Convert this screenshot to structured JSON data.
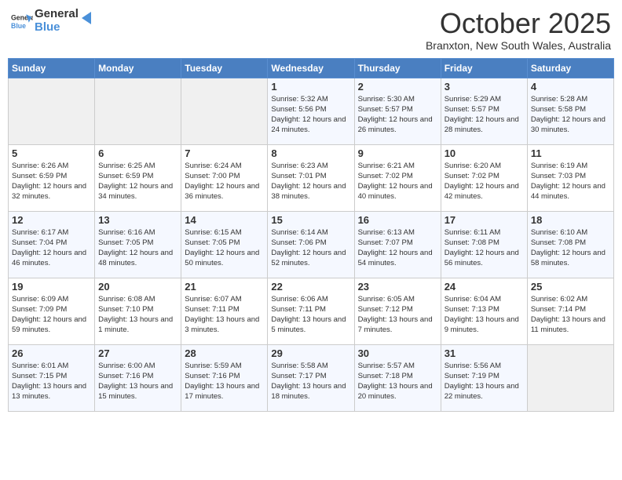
{
  "header": {
    "logo_general": "General",
    "logo_blue": "Blue",
    "month_title": "October 2025",
    "location": "Branxton, New South Wales, Australia"
  },
  "weekdays": [
    "Sunday",
    "Monday",
    "Tuesday",
    "Wednesday",
    "Thursday",
    "Friday",
    "Saturday"
  ],
  "weeks": [
    [
      {
        "day": "",
        "sunrise": "",
        "sunset": "",
        "daylight": "",
        "empty": true
      },
      {
        "day": "",
        "sunrise": "",
        "sunset": "",
        "daylight": "",
        "empty": true
      },
      {
        "day": "",
        "sunrise": "",
        "sunset": "",
        "daylight": "",
        "empty": true
      },
      {
        "day": "1",
        "sunrise": "Sunrise: 5:32 AM",
        "sunset": "Sunset: 5:56 PM",
        "daylight": "Daylight: 12 hours and 24 minutes."
      },
      {
        "day": "2",
        "sunrise": "Sunrise: 5:30 AM",
        "sunset": "Sunset: 5:57 PM",
        "daylight": "Daylight: 12 hours and 26 minutes."
      },
      {
        "day": "3",
        "sunrise": "Sunrise: 5:29 AM",
        "sunset": "Sunset: 5:57 PM",
        "daylight": "Daylight: 12 hours and 28 minutes."
      },
      {
        "day": "4",
        "sunrise": "Sunrise: 5:28 AM",
        "sunset": "Sunset: 5:58 PM",
        "daylight": "Daylight: 12 hours and 30 minutes."
      }
    ],
    [
      {
        "day": "5",
        "sunrise": "Sunrise: 6:26 AM",
        "sunset": "Sunset: 6:59 PM",
        "daylight": "Daylight: 12 hours and 32 minutes."
      },
      {
        "day": "6",
        "sunrise": "Sunrise: 6:25 AM",
        "sunset": "Sunset: 6:59 PM",
        "daylight": "Daylight: 12 hours and 34 minutes."
      },
      {
        "day": "7",
        "sunrise": "Sunrise: 6:24 AM",
        "sunset": "Sunset: 7:00 PM",
        "daylight": "Daylight: 12 hours and 36 minutes."
      },
      {
        "day": "8",
        "sunrise": "Sunrise: 6:23 AM",
        "sunset": "Sunset: 7:01 PM",
        "daylight": "Daylight: 12 hours and 38 minutes."
      },
      {
        "day": "9",
        "sunrise": "Sunrise: 6:21 AM",
        "sunset": "Sunset: 7:02 PM",
        "daylight": "Daylight: 12 hours and 40 minutes."
      },
      {
        "day": "10",
        "sunrise": "Sunrise: 6:20 AM",
        "sunset": "Sunset: 7:02 PM",
        "daylight": "Daylight: 12 hours and 42 minutes."
      },
      {
        "day": "11",
        "sunrise": "Sunrise: 6:19 AM",
        "sunset": "Sunset: 7:03 PM",
        "daylight": "Daylight: 12 hours and 44 minutes."
      }
    ],
    [
      {
        "day": "12",
        "sunrise": "Sunrise: 6:17 AM",
        "sunset": "Sunset: 7:04 PM",
        "daylight": "Daylight: 12 hours and 46 minutes."
      },
      {
        "day": "13",
        "sunrise": "Sunrise: 6:16 AM",
        "sunset": "Sunset: 7:05 PM",
        "daylight": "Daylight: 12 hours and 48 minutes."
      },
      {
        "day": "14",
        "sunrise": "Sunrise: 6:15 AM",
        "sunset": "Sunset: 7:05 PM",
        "daylight": "Daylight: 12 hours and 50 minutes."
      },
      {
        "day": "15",
        "sunrise": "Sunrise: 6:14 AM",
        "sunset": "Sunset: 7:06 PM",
        "daylight": "Daylight: 12 hours and 52 minutes."
      },
      {
        "day": "16",
        "sunrise": "Sunrise: 6:13 AM",
        "sunset": "Sunset: 7:07 PM",
        "daylight": "Daylight: 12 hours and 54 minutes."
      },
      {
        "day": "17",
        "sunrise": "Sunrise: 6:11 AM",
        "sunset": "Sunset: 7:08 PM",
        "daylight": "Daylight: 12 hours and 56 minutes."
      },
      {
        "day": "18",
        "sunrise": "Sunrise: 6:10 AM",
        "sunset": "Sunset: 7:08 PM",
        "daylight": "Daylight: 12 hours and 58 minutes."
      }
    ],
    [
      {
        "day": "19",
        "sunrise": "Sunrise: 6:09 AM",
        "sunset": "Sunset: 7:09 PM",
        "daylight": "Daylight: 12 hours and 59 minutes."
      },
      {
        "day": "20",
        "sunrise": "Sunrise: 6:08 AM",
        "sunset": "Sunset: 7:10 PM",
        "daylight": "Daylight: 13 hours and 1 minute."
      },
      {
        "day": "21",
        "sunrise": "Sunrise: 6:07 AM",
        "sunset": "Sunset: 7:11 PM",
        "daylight": "Daylight: 13 hours and 3 minutes."
      },
      {
        "day": "22",
        "sunrise": "Sunrise: 6:06 AM",
        "sunset": "Sunset: 7:11 PM",
        "daylight": "Daylight: 13 hours and 5 minutes."
      },
      {
        "day": "23",
        "sunrise": "Sunrise: 6:05 AM",
        "sunset": "Sunset: 7:12 PM",
        "daylight": "Daylight: 13 hours and 7 minutes."
      },
      {
        "day": "24",
        "sunrise": "Sunrise: 6:04 AM",
        "sunset": "Sunset: 7:13 PM",
        "daylight": "Daylight: 13 hours and 9 minutes."
      },
      {
        "day": "25",
        "sunrise": "Sunrise: 6:02 AM",
        "sunset": "Sunset: 7:14 PM",
        "daylight": "Daylight: 13 hours and 11 minutes."
      }
    ],
    [
      {
        "day": "26",
        "sunrise": "Sunrise: 6:01 AM",
        "sunset": "Sunset: 7:15 PM",
        "daylight": "Daylight: 13 hours and 13 minutes."
      },
      {
        "day": "27",
        "sunrise": "Sunrise: 6:00 AM",
        "sunset": "Sunset: 7:16 PM",
        "daylight": "Daylight: 13 hours and 15 minutes."
      },
      {
        "day": "28",
        "sunrise": "Sunrise: 5:59 AM",
        "sunset": "Sunset: 7:16 PM",
        "daylight": "Daylight: 13 hours and 17 minutes."
      },
      {
        "day": "29",
        "sunrise": "Sunrise: 5:58 AM",
        "sunset": "Sunset: 7:17 PM",
        "daylight": "Daylight: 13 hours and 18 minutes."
      },
      {
        "day": "30",
        "sunrise": "Sunrise: 5:57 AM",
        "sunset": "Sunset: 7:18 PM",
        "daylight": "Daylight: 13 hours and 20 minutes."
      },
      {
        "day": "31",
        "sunrise": "Sunrise: 5:56 AM",
        "sunset": "Sunset: 7:19 PM",
        "daylight": "Daylight: 13 hours and 22 minutes."
      },
      {
        "day": "",
        "sunrise": "",
        "sunset": "",
        "daylight": "",
        "empty": true
      }
    ]
  ]
}
